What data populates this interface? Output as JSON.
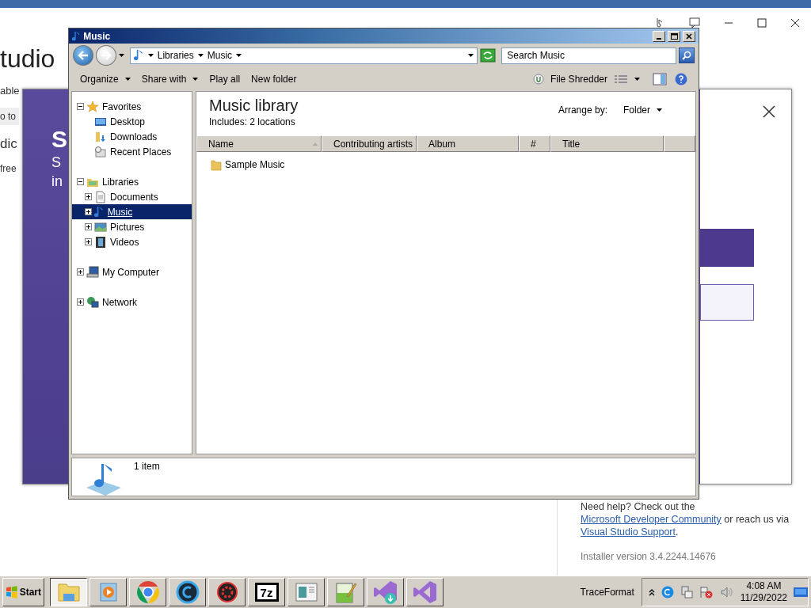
{
  "installer": {
    "heading": "tudio",
    "side_texts": [
      "able",
      "o to",
      "dic",
      "free"
    ],
    "dialog": {
      "texts": [
        "S",
        "S",
        "in"
      ]
    },
    "help": [
      {
        "text": "Need help? Check out the ",
        "kind": "text"
      },
      {
        "text": "Microsoft Developer Community",
        "kind": "link"
      },
      {
        "text": " or reach us via ",
        "kind": "text"
      },
      {
        "text": "Visual Studio Support",
        "kind": "link"
      },
      {
        "text": ".",
        "kind": "text"
      }
    ],
    "version": "Installer version 3.4.2244.14676"
  },
  "explorer": {
    "title": "Music",
    "breadcrumb": [
      "Libraries",
      "Music"
    ],
    "search": {
      "placeholder": "Search Music"
    },
    "toolbar": [
      {
        "label": "Organize",
        "dropdown": true
      },
      {
        "label": "Share with",
        "dropdown": true
      },
      {
        "label": "Play all",
        "dropdown": false
      },
      {
        "label": "New folder",
        "dropdown": false
      }
    ],
    "file_shredder": "File Shredder",
    "nav": [
      {
        "label": "Favorites",
        "kind": "node",
        "expanded": true,
        "selected": false,
        "children": [
          {
            "label": "Desktop",
            "kind": "leaf",
            "selected": false
          },
          {
            "label": "Downloads",
            "kind": "leaf",
            "selected": false
          },
          {
            "label": "Recent Places",
            "kind": "leaf",
            "selected": false
          }
        ]
      },
      {
        "label": "Libraries",
        "kind": "node",
        "expanded": true,
        "selected": false,
        "children": [
          {
            "label": "Documents",
            "kind": "node",
            "expanded": false,
            "selected": false
          },
          {
            "label": "Music",
            "kind": "node",
            "expanded": false,
            "selected": true
          },
          {
            "label": "Pictures",
            "kind": "node",
            "expanded": false,
            "selected": false
          },
          {
            "label": "Videos",
            "kind": "node",
            "expanded": false,
            "selected": false
          }
        ]
      },
      {
        "label": "My Computer",
        "kind": "node",
        "expanded": false,
        "selected": false
      },
      {
        "label": "Network",
        "kind": "node",
        "expanded": false,
        "selected": false
      }
    ],
    "library": {
      "title": "Music library",
      "includes": "Includes:  2 locations",
      "arrange_label": "Arrange by:",
      "arrange_value": "Folder"
    },
    "columns": [
      {
        "label": "Name",
        "sorted": true
      },
      {
        "label": "Contributing artists",
        "sorted": false
      },
      {
        "label": "Album",
        "sorted": false
      },
      {
        "label": "#",
        "sorted": false
      },
      {
        "label": "Title",
        "sorted": false
      },
      {
        "sorted": false
      }
    ],
    "rows": [
      {
        "name": "Sample Music"
      }
    ],
    "details": "1 item"
  },
  "taskbar": {
    "start": "Start",
    "apps": [
      {
        "selected": true
      },
      {
        "selected": false
      },
      {
        "selected": false
      },
      {
        "selected": false
      },
      {
        "selected": false
      },
      {
        "label": "7z",
        "selected": false
      },
      {
        "selected": false
      },
      {
        "selected": false
      },
      {
        "selected": false
      },
      {
        "selected": false
      }
    ],
    "tray_label": "TraceFormat",
    "time": "4:08 AM",
    "date": "11/29/2022"
  }
}
